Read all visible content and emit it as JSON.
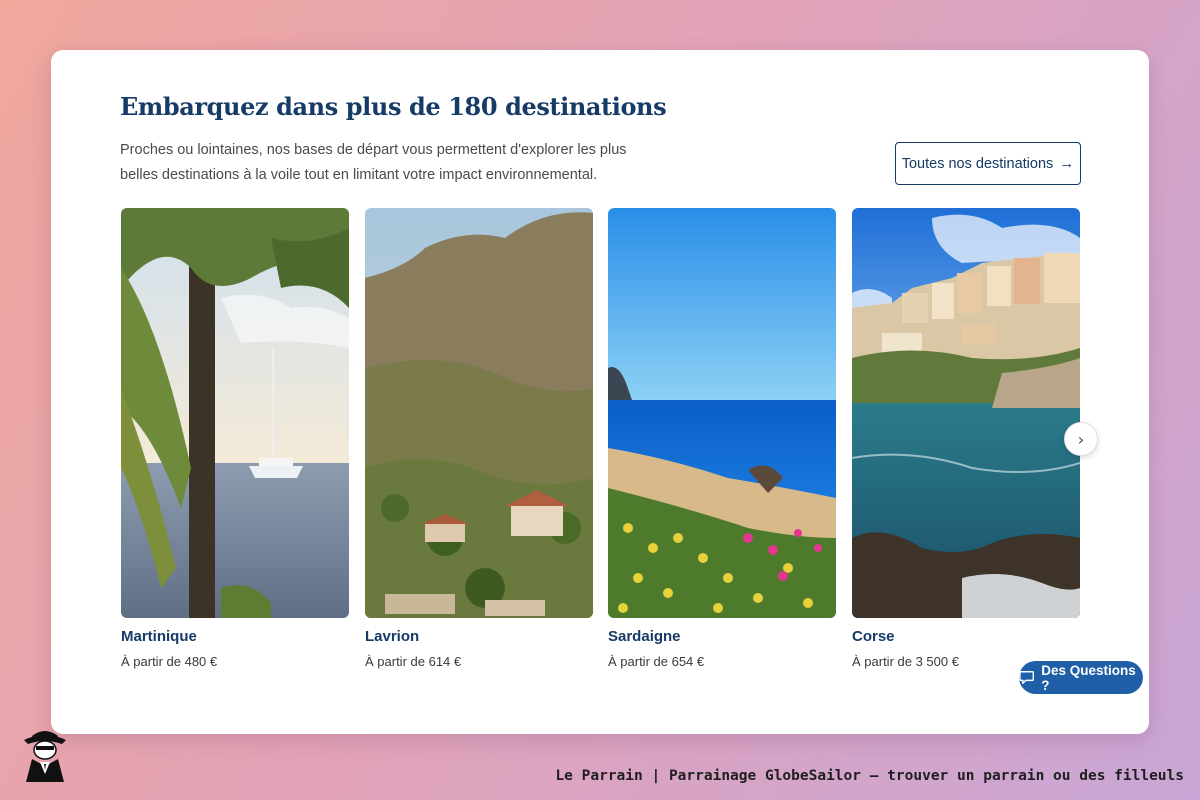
{
  "section": {
    "title": "Embarquez dans plus de 180 destinations",
    "description": "Proches ou lointaines, nos bases de départ vous permettent d'explorer les plus belles destinations à la voile tout en limitant votre impact environnemental.",
    "all_destinations_label": "Toutes nos destinations",
    "all_destinations_icon": "arrow-right-icon"
  },
  "destinations": [
    {
      "name": "Martinique",
      "price": "À partir de 480 €"
    },
    {
      "name": "Lavrion",
      "price": "À partir de 614 €"
    },
    {
      "name": "Sardaigne",
      "price": "À partir de 654 €"
    },
    {
      "name": "Corse",
      "price": "À partir de 3 500 €"
    }
  ],
  "carousel": {
    "next_icon": "chevron-right-icon"
  },
  "chat": {
    "label": "Des Questions ?",
    "icon": "chat-bubble-icon"
  },
  "footer": {
    "caption": "Le Parrain | Parrainage GlobeSailor — trouver un parrain ou des filleuls",
    "logo_icon": "godfather-logo-icon"
  },
  "colors": {
    "brand_navy": "#163b66",
    "chat_blue": "#1f5fa8",
    "background_gradient": [
      "#f0a79c",
      "#e3a3b8",
      "#c9a6d6"
    ]
  }
}
